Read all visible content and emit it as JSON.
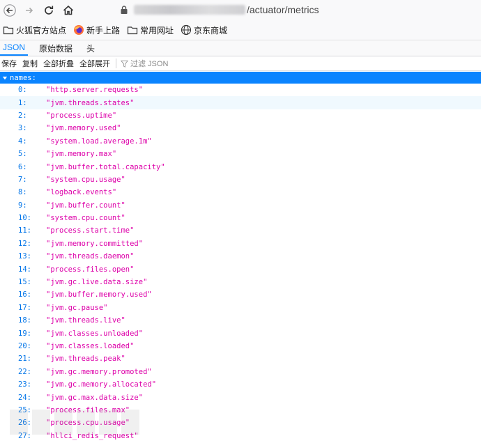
{
  "url": {
    "path": "/actuator/metrics"
  },
  "bookmarks": [
    {
      "label": "火狐官方站点",
      "icon": "folder-icon"
    },
    {
      "label": "新手上路",
      "icon": "firefox-icon"
    },
    {
      "label": "常用网址",
      "icon": "folder-icon"
    },
    {
      "label": "京东商城",
      "icon": "globe-icon"
    }
  ],
  "tabs": [
    {
      "label": "JSON",
      "active": true
    },
    {
      "label": "原始数据"
    },
    {
      "label": "头"
    }
  ],
  "toolbar": {
    "save": "保存",
    "copy": "复制",
    "collapse_all": "全部折叠",
    "expand_all": "全部展开",
    "filter_placeholder": "过滤 JSON"
  },
  "json": {
    "root_key": "names:",
    "items": [
      {
        "index": "0:",
        "value": "\"http.server.requests\""
      },
      {
        "index": "1:",
        "value": "\"jvm.threads.states\""
      },
      {
        "index": "2:",
        "value": "\"process.uptime\""
      },
      {
        "index": "3:",
        "value": "\"jvm.memory.used\""
      },
      {
        "index": "4:",
        "value": "\"system.load.average.1m\""
      },
      {
        "index": "5:",
        "value": "\"jvm.memory.max\""
      },
      {
        "index": "6:",
        "value": "\"jvm.buffer.total.capacity\""
      },
      {
        "index": "7:",
        "value": "\"system.cpu.usage\""
      },
      {
        "index": "8:",
        "value": "\"logback.events\""
      },
      {
        "index": "9:",
        "value": "\"jvm.buffer.count\""
      },
      {
        "index": "10:",
        "value": "\"system.cpu.count\""
      },
      {
        "index": "11:",
        "value": "\"process.start.time\""
      },
      {
        "index": "12:",
        "value": "\"jvm.memory.committed\""
      },
      {
        "index": "13:",
        "value": "\"jvm.threads.daemon\""
      },
      {
        "index": "14:",
        "value": "\"process.files.open\""
      },
      {
        "index": "15:",
        "value": "\"jvm.gc.live.data.size\""
      },
      {
        "index": "16:",
        "value": "\"jvm.buffer.memory.used\""
      },
      {
        "index": "17:",
        "value": "\"jvm.gc.pause\""
      },
      {
        "index": "18:",
        "value": "\"jvm.threads.live\""
      },
      {
        "index": "19:",
        "value": "\"jvm.classes.unloaded\""
      },
      {
        "index": "20:",
        "value": "\"jvm.classes.loaded\""
      },
      {
        "index": "21:",
        "value": "\"jvm.threads.peak\""
      },
      {
        "index": "22:",
        "value": "\"jvm.gc.memory.promoted\""
      },
      {
        "index": "23:",
        "value": "\"jvm.gc.memory.allocated\""
      },
      {
        "index": "24:",
        "value": "\"jvm.gc.max.data.size\""
      },
      {
        "index": "25:",
        "value": "\"process.files.max\""
      },
      {
        "index": "26:",
        "value": "\"process.cpu.usage\""
      },
      {
        "index": "27:",
        "value": "\"hllci_redis_request\""
      }
    ]
  },
  "colors": {
    "accent": "#0a84ff",
    "index": "#0074e8",
    "string": "#dd00a9",
    "row_highlight": "#f0f9fe"
  }
}
